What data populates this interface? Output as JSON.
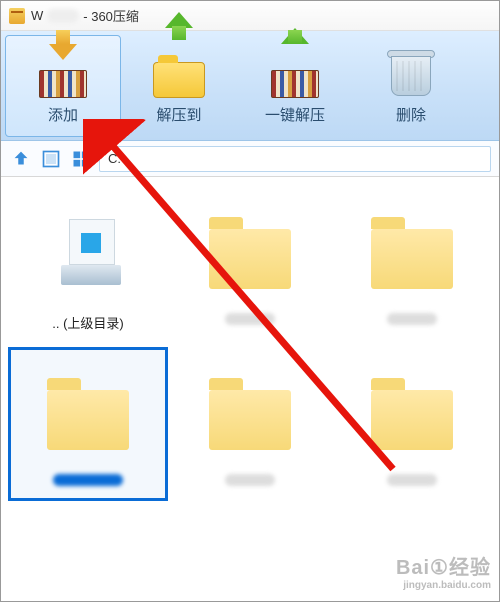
{
  "title": {
    "prefix": "W",
    "suffix": "- 360压缩"
  },
  "toolbar": {
    "add": "添加",
    "extract": "解压到",
    "onekey": "一键解压",
    "delete": "删除"
  },
  "path": {
    "value": "C:\\"
  },
  "items": [
    {
      "label": ".. (上级目录)"
    },
    {
      "label": ""
    },
    {
      "label": ""
    },
    {
      "label": ""
    },
    {
      "label": ""
    },
    {
      "label": ""
    },
    {
      "label": ""
    },
    {
      "label": ""
    }
  ],
  "watermark": {
    "main": "Bai①经验",
    "sub": "jingyan.baidu.com"
  }
}
